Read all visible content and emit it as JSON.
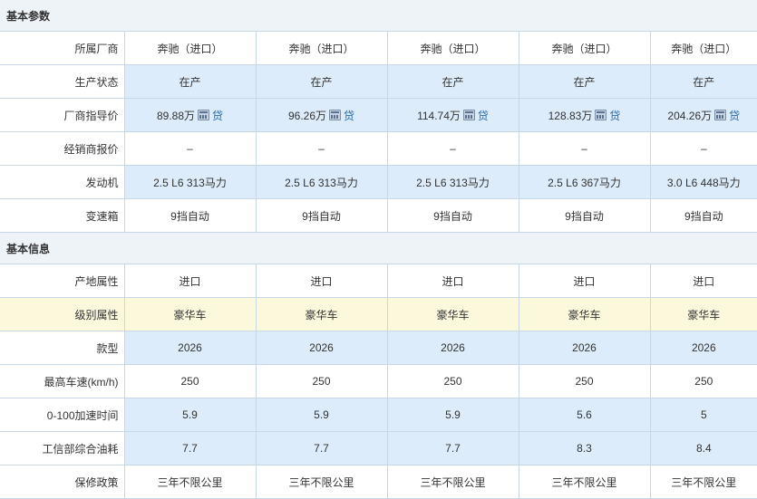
{
  "sections": [
    {
      "title": "基本参数",
      "rows": [
        {
          "label": "所属厂商",
          "style": "plain",
          "values": [
            "奔驰（进口）",
            "奔驰（进口）",
            "奔驰（进口）",
            "奔驰（进口）",
            "奔驰（进口）"
          ]
        },
        {
          "label": "生产状态",
          "style": "hl",
          "values": [
            "在产",
            "在产",
            "在产",
            "在产",
            "在产"
          ]
        },
        {
          "label": "厂商指导价",
          "style": "hl",
          "type": "price",
          "values": [
            "89.88万",
            "96.26万",
            "114.74万",
            "128.83万",
            "204.26万"
          ],
          "loan_label": "贷",
          "icon": "calculator-icon"
        },
        {
          "label": "经销商报价",
          "style": "plain",
          "values": [
            "–",
            "–",
            "–",
            "–",
            "–"
          ]
        },
        {
          "label": "发动机",
          "style": "hl",
          "values": [
            "2.5 L6 313马力",
            "2.5 L6 313马力",
            "2.5 L6 313马力",
            "2.5 L6 367马力",
            "3.0 L6 448马力"
          ]
        },
        {
          "label": "变速箱",
          "style": "plain",
          "values": [
            "9挡自动",
            "9挡自动",
            "9挡自动",
            "9挡自动",
            "9挡自动"
          ]
        }
      ]
    },
    {
      "title": "基本信息",
      "rows": [
        {
          "label": "产地属性",
          "style": "plain",
          "values": [
            "进口",
            "进口",
            "进口",
            "进口",
            "进口"
          ]
        },
        {
          "label": "级别属性",
          "style": "hl-yellow",
          "values": [
            "豪华车",
            "豪华车",
            "豪华车",
            "豪华车",
            "豪华车"
          ]
        },
        {
          "label": "款型",
          "style": "hl",
          "values": [
            "2026",
            "2026",
            "2026",
            "2026",
            "2026"
          ]
        },
        {
          "label": "最高车速(km/h)",
          "style": "plain",
          "values": [
            "250",
            "250",
            "250",
            "250",
            "250"
          ]
        },
        {
          "label": "0-100加速时间",
          "style": "hl",
          "values": [
            "5.9",
            "5.9",
            "5.9",
            "5.6",
            "5"
          ]
        },
        {
          "label": "工信部综合油耗",
          "style": "hl",
          "values": [
            "7.7",
            "7.7",
            "7.7",
            "8.3",
            "8.4"
          ]
        },
        {
          "label": "保修政策",
          "style": "plain",
          "link": true,
          "values": [
            "三年不限公里",
            "三年不限公里",
            "三年不限公里",
            "三年不限公里",
            "三年不限公里"
          ]
        }
      ]
    }
  ]
}
